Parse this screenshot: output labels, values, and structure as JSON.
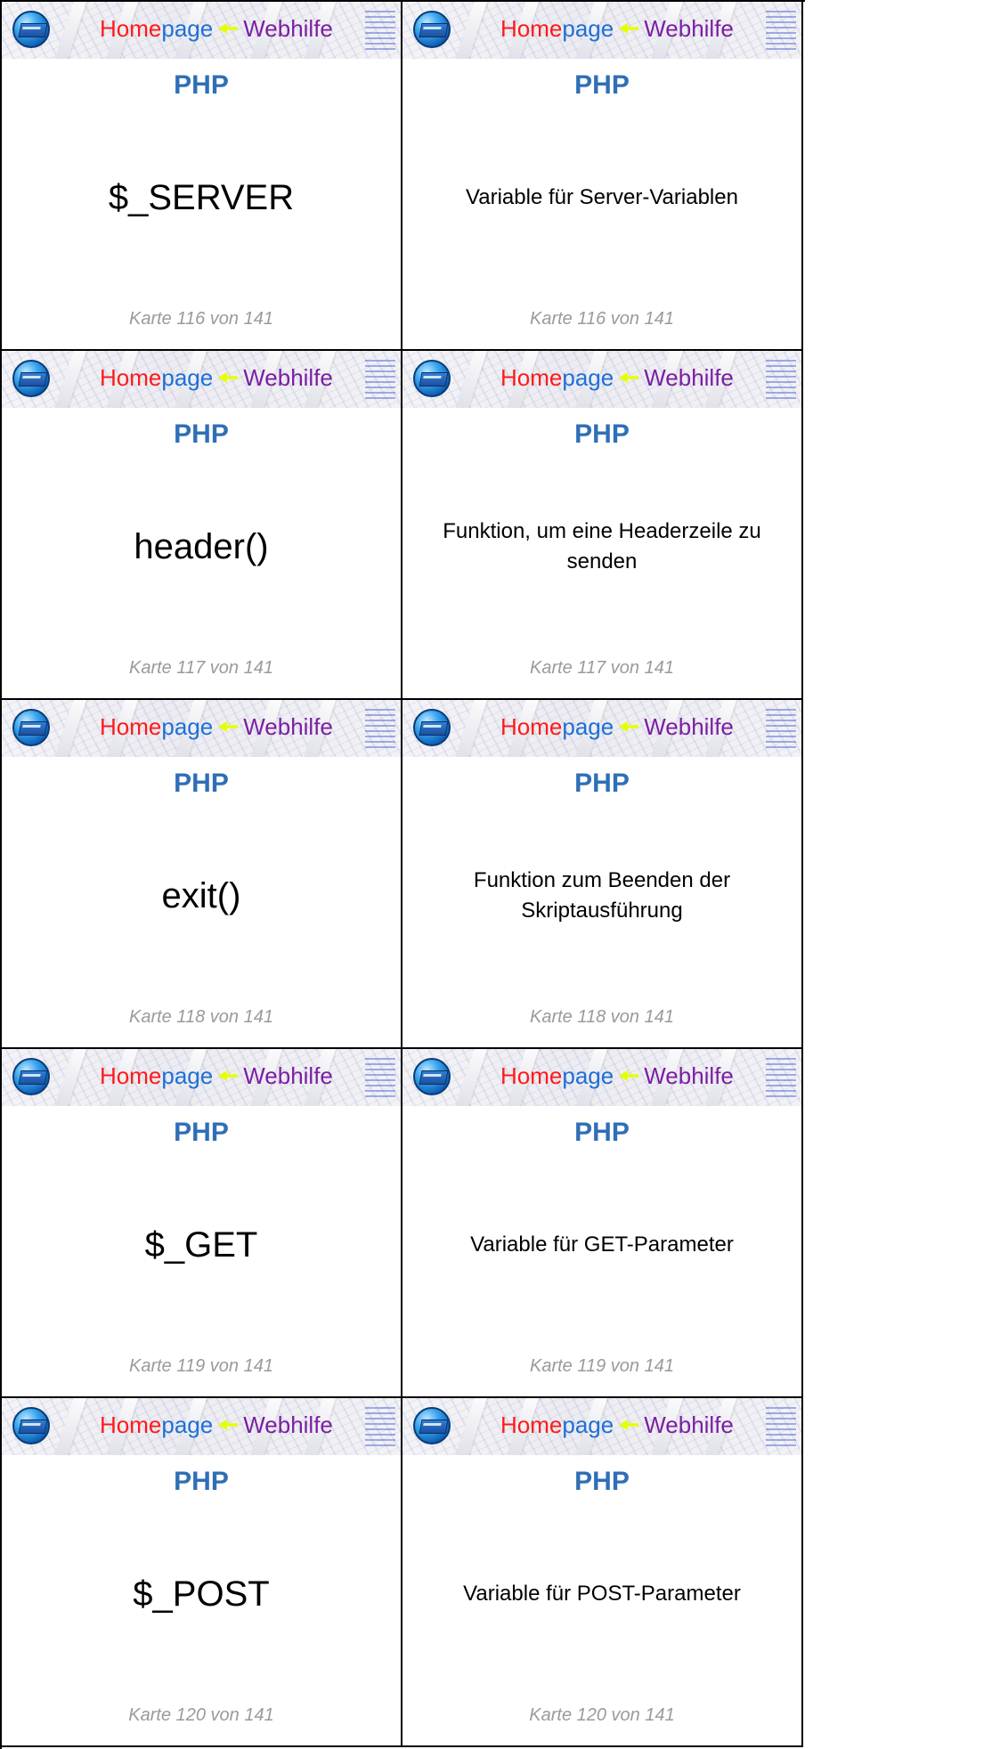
{
  "cards": [
    {
      "subject": "PHP",
      "term": "$_SERVER",
      "definition": "Variable für Server-Variablen",
      "footer": "Karte 116 von 141"
    },
    {
      "subject": "PHP",
      "term": "header()",
      "definition": "Funktion, um eine Headerzeile zu senden",
      "footer": "Karte 117 von 141"
    },
    {
      "subject": "PHP",
      "term": "exit()",
      "definition": "Funktion zum Beenden der Skriptausführung",
      "footer": "Karte 118 von 141"
    },
    {
      "subject": "PHP",
      "term": "$_GET",
      "definition": "Variable für GET-Parameter",
      "footer": "Karte 119 von 141"
    },
    {
      "subject": "PHP",
      "term": "$_POST",
      "definition": "Variable für POST-Parameter",
      "footer": "Karte 120 von 141"
    }
  ],
  "banner": {
    "brand_home": "Home",
    "brand_page": "page",
    "brand_web": "Webhilfe",
    "icon": "homepage-globe-icon",
    "colors": {
      "home": "#ff1a1a",
      "page": "#1f6fd6",
      "web": "#7b1fa2",
      "arrow": "#e6ff00",
      "subject": "#2f6fb6",
      "footer": "#9a9a9a"
    }
  }
}
